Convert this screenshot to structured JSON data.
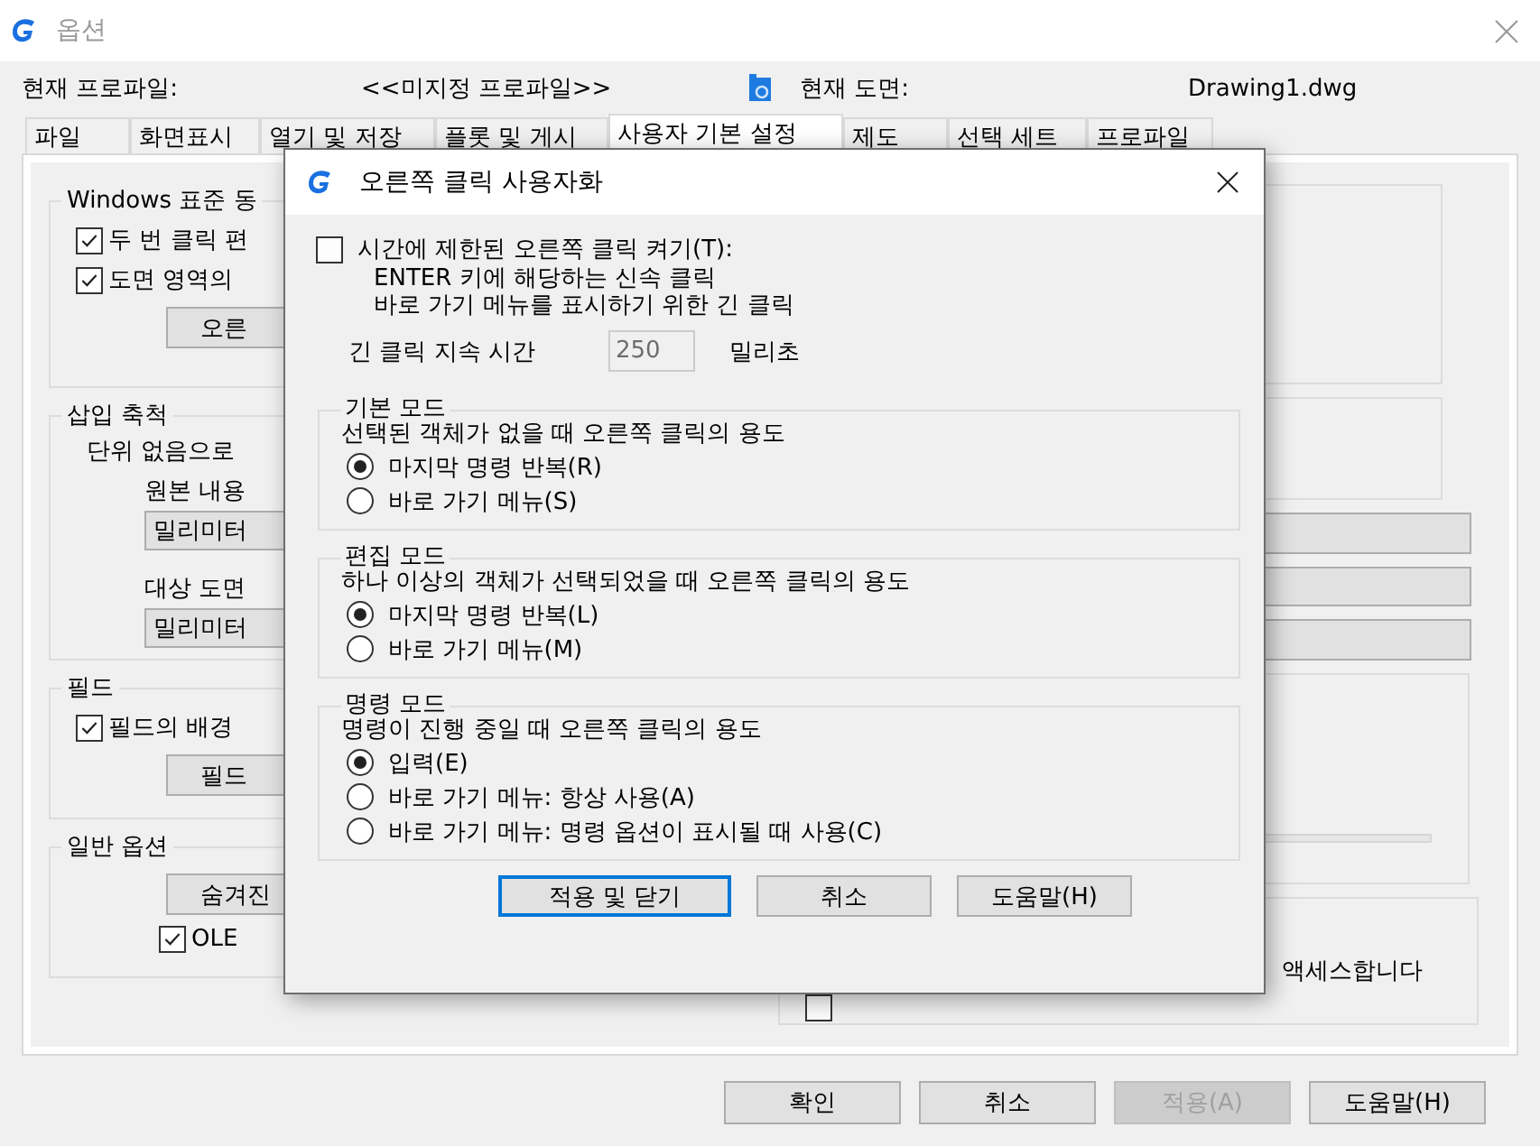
{
  "window": {
    "title": "옵션"
  },
  "profile": {
    "label": "현재 프로파일:",
    "value": "<<미지정 프로파일>>"
  },
  "drawing": {
    "label": "현재 도면:",
    "value": "Drawing1.dwg"
  },
  "tabs": [
    {
      "label": "파일",
      "selected": false
    },
    {
      "label": "화면표시",
      "selected": false
    },
    {
      "label": "열기 및 저장",
      "selected": false
    },
    {
      "label": "플롯 및 게시",
      "selected": false
    },
    {
      "label": "사용자 기본 설정",
      "selected": true
    },
    {
      "label": "제도",
      "selected": false
    },
    {
      "label": "선택 세트",
      "selected": false
    },
    {
      "label": "프로파일",
      "selected": false
    }
  ],
  "left_groups": [
    {
      "title": "Windows 표준 동",
      "items": [
        {
          "kind": "checkbox",
          "label": "두 번 클릭 편",
          "checked": true
        },
        {
          "kind": "checkbox",
          "label": "도면 영역의",
          "checked": true
        },
        {
          "kind": "button",
          "label": "오른"
        }
      ]
    },
    {
      "title": "삽입 축척",
      "items": [
        {
          "kind": "note",
          "label": "단위 없음으로"
        },
        {
          "kind": "label",
          "label": "원본 내용"
        },
        {
          "kind": "select",
          "label": "밀리미터"
        },
        {
          "kind": "label",
          "label": "대상 도면"
        },
        {
          "kind": "select",
          "label": "밀리미터"
        }
      ]
    },
    {
      "title": "필드",
      "items": [
        {
          "kind": "checkbox",
          "label": "필드의 배경",
          "checked": true
        },
        {
          "kind": "button",
          "label": "필드"
        }
      ]
    },
    {
      "title": "일반 옵션",
      "items": [
        {
          "kind": "button",
          "label": "숨겨진"
        },
        {
          "kind": "subcheckbox",
          "label": "OLE",
          "checked": true
        }
      ]
    }
  ],
  "right_checkbox": {
    "label": "액세스합니다",
    "checked": false
  },
  "buttons": [
    {
      "label": "확인",
      "disabled": false
    },
    {
      "label": "취소",
      "disabled": false
    },
    {
      "label": "적용(A)",
      "disabled": true
    },
    {
      "label": "도움말(H)",
      "disabled": false
    }
  ],
  "dialog": {
    "title": "오른쪽 클릭 사용자화",
    "timed": {
      "label": "시간에 제한된 오른쪽 클릭 켜기(T):",
      "checked": false,
      "lines": [
        "ENTER 키에 해당하는 신속 클릭",
        "바로 가기 메뉴를 표시하기 위한 긴 클릭"
      ],
      "duration_label": "긴 클릭 지속 시간",
      "duration_value": "250",
      "unit": "밀리초"
    },
    "groups": [
      {
        "title": "기본 모드",
        "description": "선택된 객체가 없을 때 오른쪽 클릭의 용도",
        "options": [
          {
            "label": "마지막 명령 반복(R)",
            "selected": true
          },
          {
            "label": "바로 가기 메뉴(S)",
            "selected": false
          }
        ]
      },
      {
        "title": "편집 모드",
        "description": "하나 이상의 객체가 선택되었을 때 오른쪽 클릭의 용도",
        "options": [
          {
            "label": "마지막 명령 반복(L)",
            "selected": true
          },
          {
            "label": "바로 가기 메뉴(M)",
            "selected": false
          }
        ]
      },
      {
        "title": "명령 모드",
        "description": "명령이 진행 중일 때 오른쪽 클릭의 용도",
        "options": [
          {
            "label": "입력(E)",
            "selected": true
          },
          {
            "label": "바로 가기 메뉴: 항상 사용(A)",
            "selected": false
          },
          {
            "label": "바로 가기 메뉴: 명령 옵션이 표시될 때 사용(C)",
            "selected": false
          }
        ]
      }
    ],
    "buttons": [
      {
        "label": "적용 및 닫기",
        "default": true
      },
      {
        "label": "취소",
        "default": false
      },
      {
        "label": "도움말(H)",
        "default": false
      }
    ]
  }
}
